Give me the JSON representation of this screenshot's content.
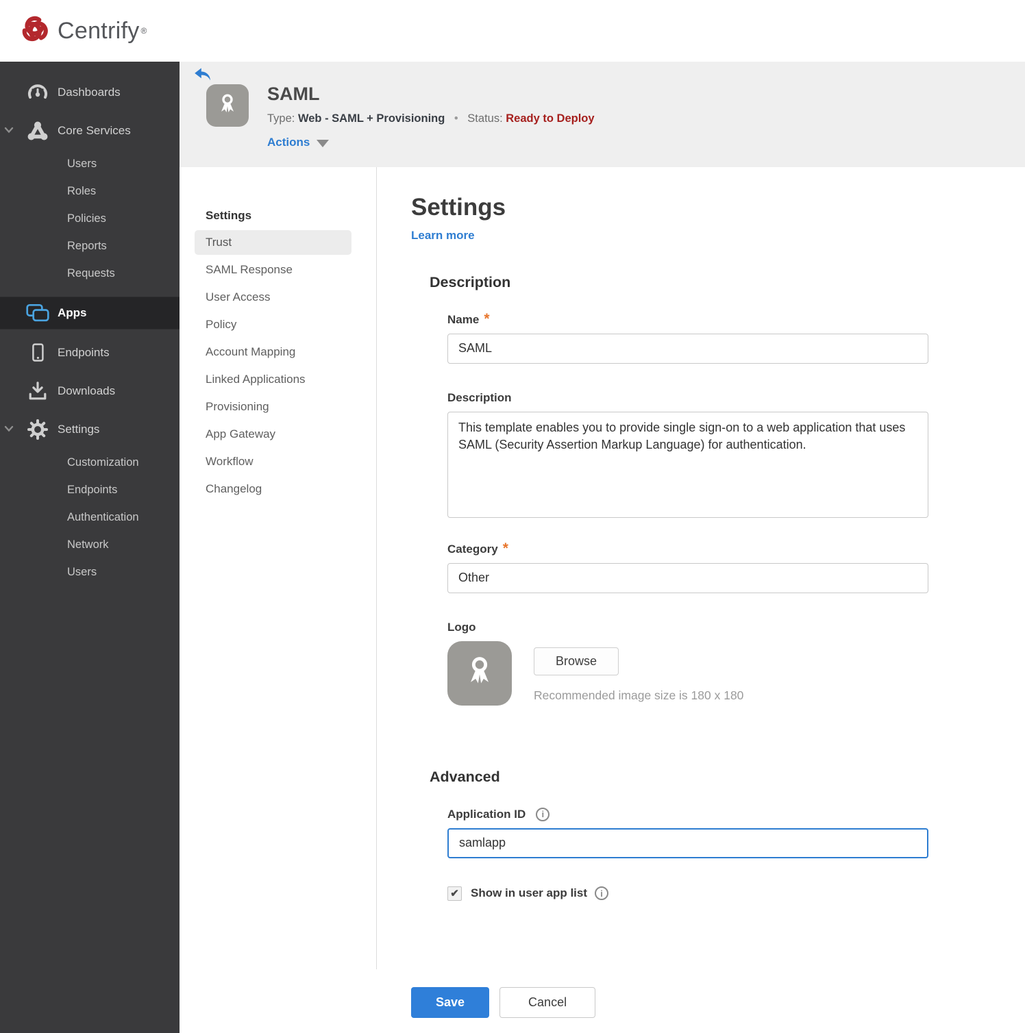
{
  "brand": {
    "name": "Centrify",
    "registered": "®"
  },
  "colors": {
    "sidebar_bg": "#3a3a3c",
    "sidebar_active_bg": "#252527",
    "accent_blue": "#2e7dd1",
    "apps_icon_blue": "#4aa3e0",
    "status_red": "#a6201e",
    "asterisk_orange": "#e8762d",
    "header_bg": "#efefef",
    "brand_red": "#b3282d",
    "save_bg": "#2f7fd9"
  },
  "sidebar": {
    "dashboards": "Dashboards",
    "core_services": "Core Services",
    "core_children": [
      "Users",
      "Roles",
      "Policies",
      "Reports",
      "Requests"
    ],
    "apps": "Apps",
    "endpoints": "Endpoints",
    "downloads": "Downloads",
    "settings": "Settings",
    "settings_children": [
      "Customization",
      "Endpoints",
      "Authentication",
      "Network",
      "Users"
    ]
  },
  "header": {
    "title": "SAML",
    "type_label": "Type:",
    "type_value": "Web - SAML + Provisioning",
    "separator": "•",
    "status_label": "Status:",
    "status_value": "Ready to Deploy",
    "actions_label": "Actions"
  },
  "subnav": {
    "heading": "Settings",
    "active_item": "Trust",
    "items": [
      "Trust",
      "SAML Response",
      "User Access",
      "Policy",
      "Account Mapping",
      "Linked Applications",
      "Provisioning",
      "App Gateway",
      "Workflow",
      "Changelog"
    ]
  },
  "main": {
    "title": "Settings",
    "learn_more": "Learn more",
    "description_section": {
      "heading": "Description",
      "name_label": "Name",
      "name_value": "SAML",
      "description_label": "Description",
      "description_value": "This template enables you to provide single sign-on to a web application that uses SAML (Security Assertion Markup Language) for authentication.",
      "category_label": "Category",
      "category_value": "Other",
      "logo_label": "Logo",
      "browse_label": "Browse",
      "logo_hint": "Recommended image size is 180 x 180"
    },
    "advanced_section": {
      "heading": "Advanced",
      "app_id_label": "Application ID",
      "app_id_value": "samlapp",
      "show_in_app_list_label": "Show in user app list",
      "show_in_app_list_checked": true
    },
    "footer": {
      "save_label": "Save",
      "cancel_label": "Cancel"
    }
  }
}
